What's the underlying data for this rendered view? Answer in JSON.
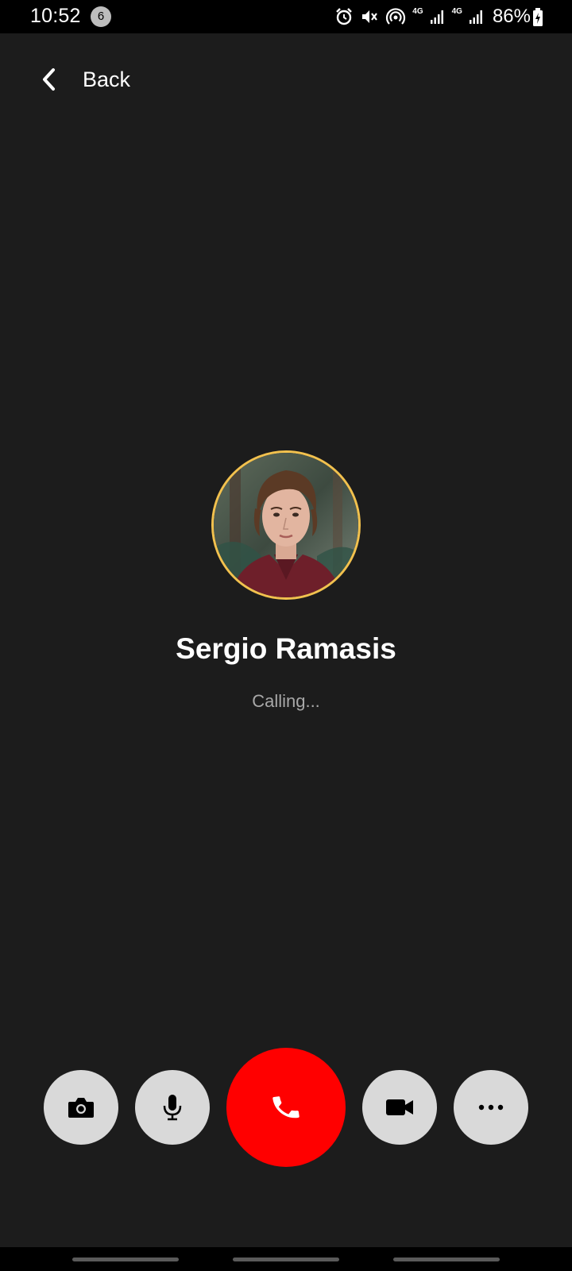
{
  "status_bar": {
    "time": "10:52",
    "notification_count": "6",
    "network_label_1": "4G",
    "network_label_2": "4G",
    "battery": "86%"
  },
  "header": {
    "back_label": "Back"
  },
  "call": {
    "caller_name": "Sergio Ramasis",
    "status": "Calling..."
  },
  "controls": [
    {
      "name": "camera",
      "icon": "camera-icon"
    },
    {
      "name": "microphone",
      "icon": "mic-icon"
    },
    {
      "name": "end-call",
      "icon": "phone-icon"
    },
    {
      "name": "video",
      "icon": "video-icon"
    },
    {
      "name": "more",
      "icon": "more-icon"
    }
  ],
  "colors": {
    "background": "#1c1c1c",
    "end_call": "#ff0000",
    "control_bg": "#d9d9d9",
    "avatar_ring": "#f2c14e",
    "status_text": "#a8a8a8"
  }
}
